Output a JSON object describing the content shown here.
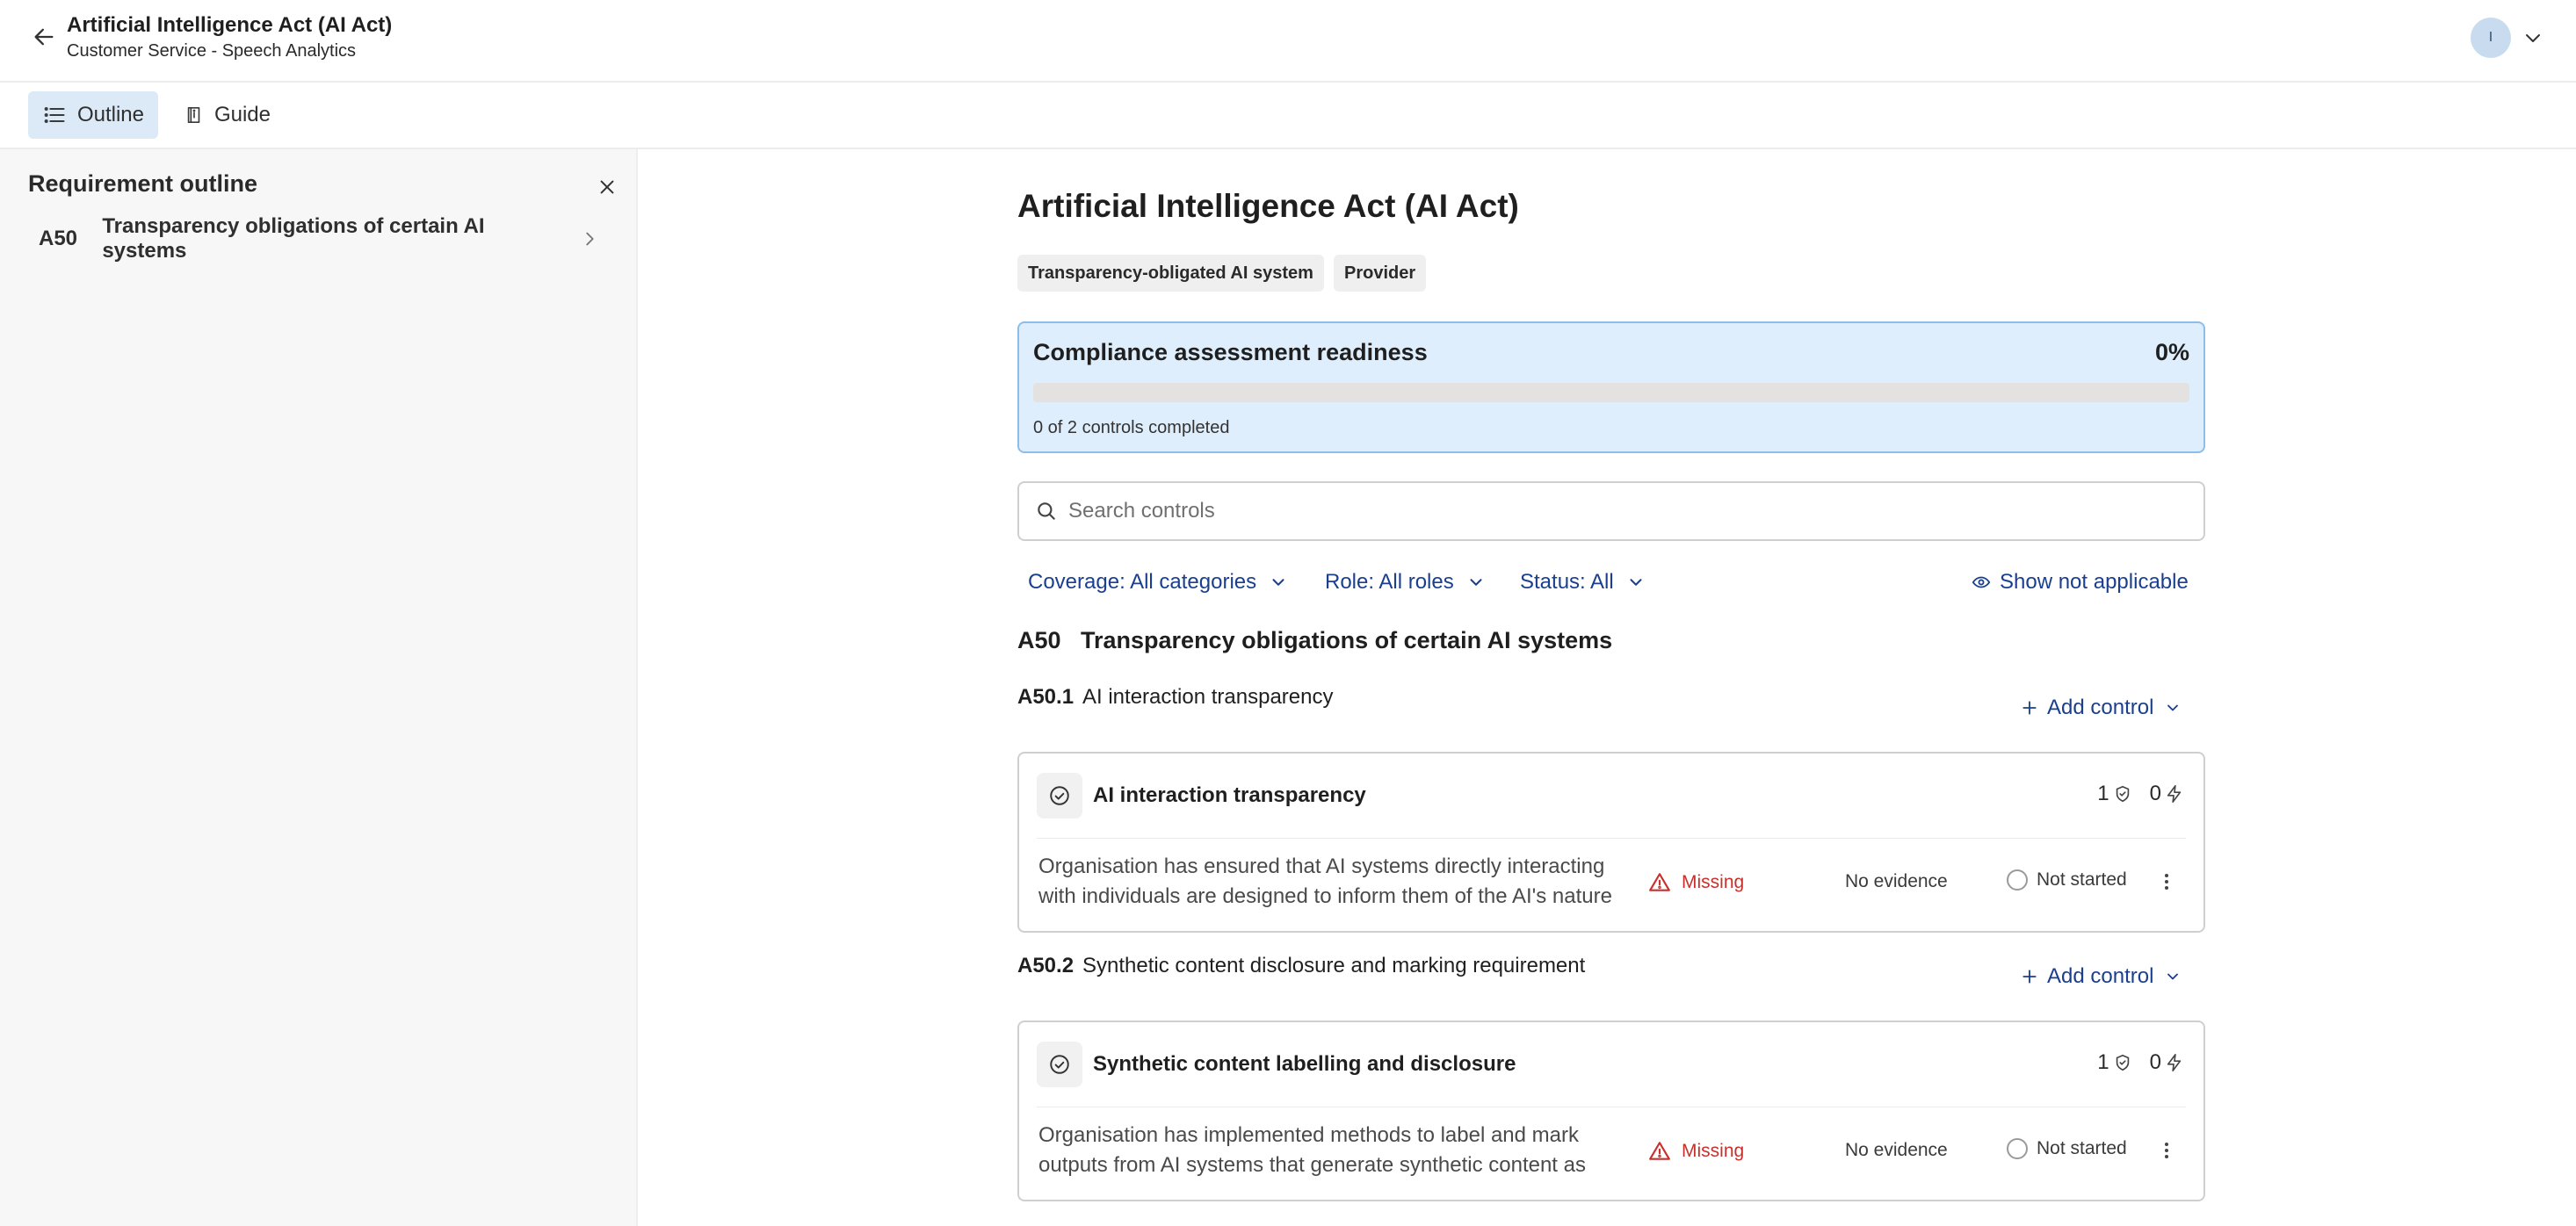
{
  "header": {
    "title": "Artificial Intelligence Act (AI Act)",
    "subtitle": "Customer Service - Speech Analytics",
    "avatar_initial": "I"
  },
  "tabs": [
    {
      "label": "Outline",
      "icon": "list-icon",
      "active": true
    },
    {
      "label": "Guide",
      "icon": "book-icon",
      "active": false
    }
  ],
  "sidebar": {
    "title": "Requirement outline",
    "items": [
      {
        "code": "A50",
        "label": "Transparency obligations of certain AI systems"
      }
    ]
  },
  "main": {
    "title": "Artificial Intelligence Act (AI Act)",
    "tags": [
      "Transparency-obligated AI system",
      "Provider"
    ],
    "readiness": {
      "title": "Compliance assessment readiness",
      "percent_label": "0%",
      "progress": 0,
      "summary": "0 of 2 controls completed"
    },
    "search": {
      "placeholder": "Search controls"
    },
    "filters": {
      "coverage": "Coverage: All categories",
      "role": "Role: All roles",
      "status": "Status: All",
      "show_not_applicable": "Show not applicable"
    },
    "section": {
      "code": "A50",
      "title": "Transparency obligations of certain AI systems"
    },
    "add_control_label": "Add control",
    "subsections": [
      {
        "code": "A50.1",
        "title": "AI interaction transparency",
        "control": {
          "title": "AI interaction transparency",
          "count_a": "1",
          "count_b": "0",
          "description": "Organisation has ensured that AI systems directly interacting with individuals are designed to inform them of the AI's nature",
          "evidence": "Missing",
          "evidence_status": "No evidence",
          "status": "Not started"
        }
      },
      {
        "code": "A50.2",
        "title": "Synthetic content disclosure and marking requirement",
        "control": {
          "title": "Synthetic content labelling and disclosure",
          "count_a": "1",
          "count_b": "0",
          "description": "Organisation has implemented methods to label and mark outputs from AI systems that generate synthetic content as",
          "evidence": "Missing",
          "evidence_status": "No evidence",
          "status": "Not started"
        }
      }
    ]
  },
  "colors": {
    "accent": "#1b3f8f",
    "readiness_bg": "#dfeefc",
    "readiness_border": "#8dbde9",
    "missing": "#c9302c",
    "active_tab": "#dce9f7"
  }
}
